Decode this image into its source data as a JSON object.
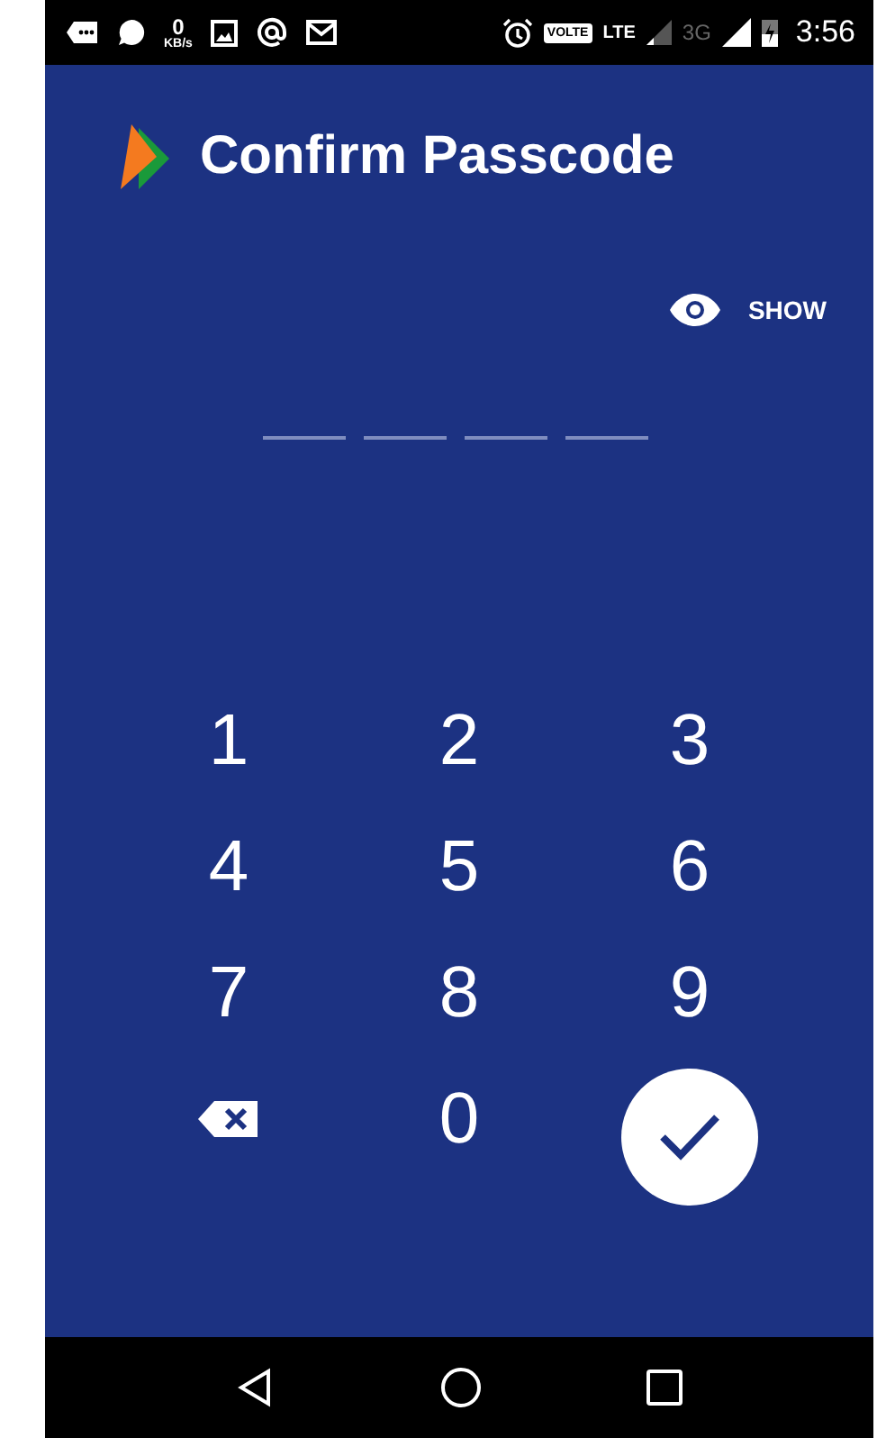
{
  "status_bar": {
    "speed_value": "0",
    "speed_unit": "KB/s",
    "volte": "VOLTE",
    "network": "LTE",
    "network_2": "3G",
    "time": "3:56"
  },
  "header": {
    "title": "Confirm Passcode"
  },
  "show_toggle": {
    "label": "SHOW"
  },
  "passcode_slots": [
    {
      "filled": false
    },
    {
      "filled": false
    },
    {
      "filled": false
    },
    {
      "filled": false
    }
  ],
  "keypad": [
    {
      "kind": "digit",
      "label": "1"
    },
    {
      "kind": "digit",
      "label": "2"
    },
    {
      "kind": "digit",
      "label": "3"
    },
    {
      "kind": "digit",
      "label": "4"
    },
    {
      "kind": "digit",
      "label": "5"
    },
    {
      "kind": "digit",
      "label": "6"
    },
    {
      "kind": "digit",
      "label": "7"
    },
    {
      "kind": "digit",
      "label": "8"
    },
    {
      "kind": "digit",
      "label": "9"
    },
    {
      "kind": "backspace"
    },
    {
      "kind": "digit",
      "label": "0"
    },
    {
      "kind": "confirm"
    }
  ]
}
